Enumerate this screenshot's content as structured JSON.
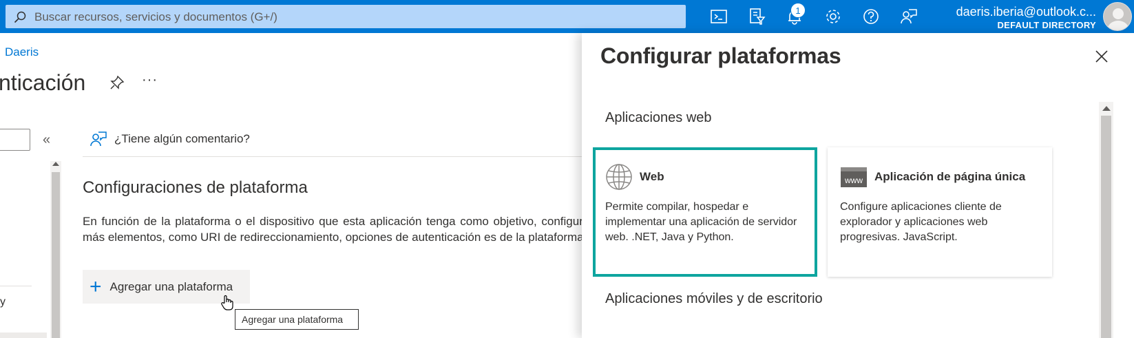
{
  "topbar": {
    "search_placeholder": "Buscar recursos, servicios y documentos (G+/)",
    "notification_count": "1",
    "account_email": "daeris.iberia@outlook.c...",
    "account_directory": "DEFAULT DIRECTORY",
    "icons": [
      "cloud-shell-icon",
      "directory-filter-icon",
      "notifications-icon",
      "settings-icon",
      "help-icon",
      "feedback-icon"
    ]
  },
  "page": {
    "breadcrumb": "Daeris",
    "title": "nticación",
    "more": "···",
    "collapse": "«",
    "left_partial_text": "y",
    "feedback": "¿Tiene algún comentario?",
    "section_title": "Configuraciones de plataforma",
    "section_desc": "En función de la plataforma o el dispositivo que esta aplicación tenga como objetivo, configurar más elementos, como URI de redireccionamiento, opciones de autenticación es de la plataforma.",
    "add_button": "Agregar una plataforma",
    "tooltip": "Agregar una plataforma"
  },
  "panel": {
    "title": "Configurar plataformas",
    "groups": [
      {
        "title": "Aplicaciones web",
        "cards": [
          {
            "title": "Web",
            "icon": "globe-icon",
            "desc": "Permite compilar, hospedar e implementar una aplicación de servidor web. .NET, Java y Python.",
            "selected": true
          },
          {
            "title": "Aplicación de página única",
            "icon": "www-icon",
            "icon_text": "www",
            "desc": "Configure aplicaciones cliente de explorador y aplicaciones web progresivas. JavaScript.",
            "selected": false
          }
        ]
      },
      {
        "title": "Aplicaciones móviles y de escritorio"
      }
    ]
  },
  "colors": {
    "brand": "#0078d4",
    "selected_border": "#0ea59f",
    "search_bg": "#b4d6fa"
  }
}
